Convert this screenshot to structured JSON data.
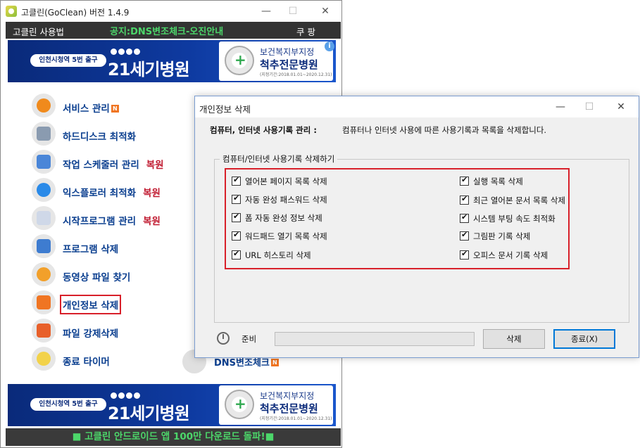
{
  "main_window": {
    "title": "고클린(GoClean) 버전 1.4.9",
    "menubar": {
      "left": "고클린 사용법",
      "notice": "공지:DNS변조체크-오진안내",
      "right": "쿠 팡"
    },
    "banner": {
      "subway": "인천시청역 5번 출구",
      "hospital": "21세기병원",
      "right_line1": "보건복지부지정",
      "right_line2": "척추전문병원",
      "right_line3": "(지정기간:2018.01.01~2020.12.31)"
    },
    "menu": [
      {
        "label": "서비스 관리",
        "tag": "",
        "new": "N"
      },
      {
        "label": "하드디스크 최적화",
        "tag": "",
        "new": ""
      },
      {
        "label": "작업 스케줄러 관리",
        "tag": "복원",
        "new": ""
      },
      {
        "label": "익스플로러 최적화",
        "tag": "복원",
        "new": ""
      },
      {
        "label": "시작프로그램 관리",
        "tag": "복원",
        "new": ""
      },
      {
        "label": "프로그램 삭제",
        "tag": "",
        "new": ""
      },
      {
        "label": "동영상 파일 찾기",
        "tag": "",
        "new": ""
      },
      {
        "label": "개인정보 삭제",
        "tag": "",
        "new": ""
      },
      {
        "label": "파일 강제삭제",
        "tag": "",
        "new": ""
      },
      {
        "label": "종료 타이머",
        "tag": "",
        "new": ""
      }
    ],
    "dns_label": "DNS변조체크",
    "dns_new": "N",
    "bottom_bar": "■ 고클린 안드로이드 앱 100만 다운로드 돌파!■"
  },
  "dialog": {
    "title": "개인정보 삭제",
    "desc_label": "컴퓨터, 인터넷 사용기록 관리 :",
    "desc_text": "컴퓨터나 인터넷 사용에 따른 사용기록과 목록을 삭제합니다.",
    "group_label": "컴퓨터/인터넷 사용기록 삭제하기",
    "left_checks": [
      {
        "label": "열어본 페이지 목록 삭제",
        "checked": true
      },
      {
        "label": "자동 완성 패스워드 삭제",
        "checked": true
      },
      {
        "label": "폼 자동 완성 정보 삭제",
        "checked": true
      },
      {
        "label": "워드패드 열기 목록 삭제",
        "checked": true
      },
      {
        "label": "URL 히스토리 삭제",
        "checked": true
      }
    ],
    "right_checks": [
      {
        "label": "실행 목록 삭제",
        "checked": true
      },
      {
        "label": "최근 열어본 문서 목록 삭제",
        "checked": true
      },
      {
        "label": "시스템 부팅 속도 최적화",
        "checked": true
      },
      {
        "label": "그림판 기록 삭제",
        "checked": true
      },
      {
        "label": "오피스 문서 기록 삭제",
        "checked": true
      }
    ],
    "status": "준비",
    "delete_button": "삭제",
    "close_button": "종료(X)"
  }
}
